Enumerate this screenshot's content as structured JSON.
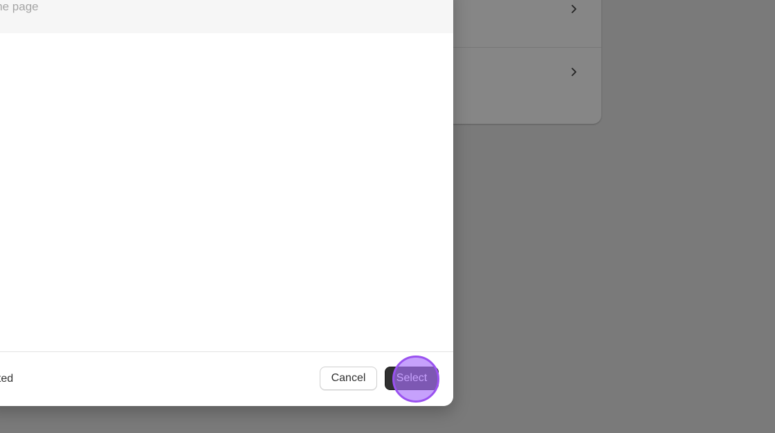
{
  "search": {
    "placeholder_visible": "ome page"
  },
  "footer": {
    "status_visible": "ected",
    "cancel_label": "Cancel",
    "select_label": "Select"
  },
  "background": {
    "rows": [
      {
        "icon": "chevron-right-icon"
      },
      {
        "icon": "chevron-right-icon"
      }
    ]
  },
  "colors": {
    "overlay": "#7a7a7a",
    "primary_button": "#303030",
    "click_indicator": "#9a52f0"
  }
}
